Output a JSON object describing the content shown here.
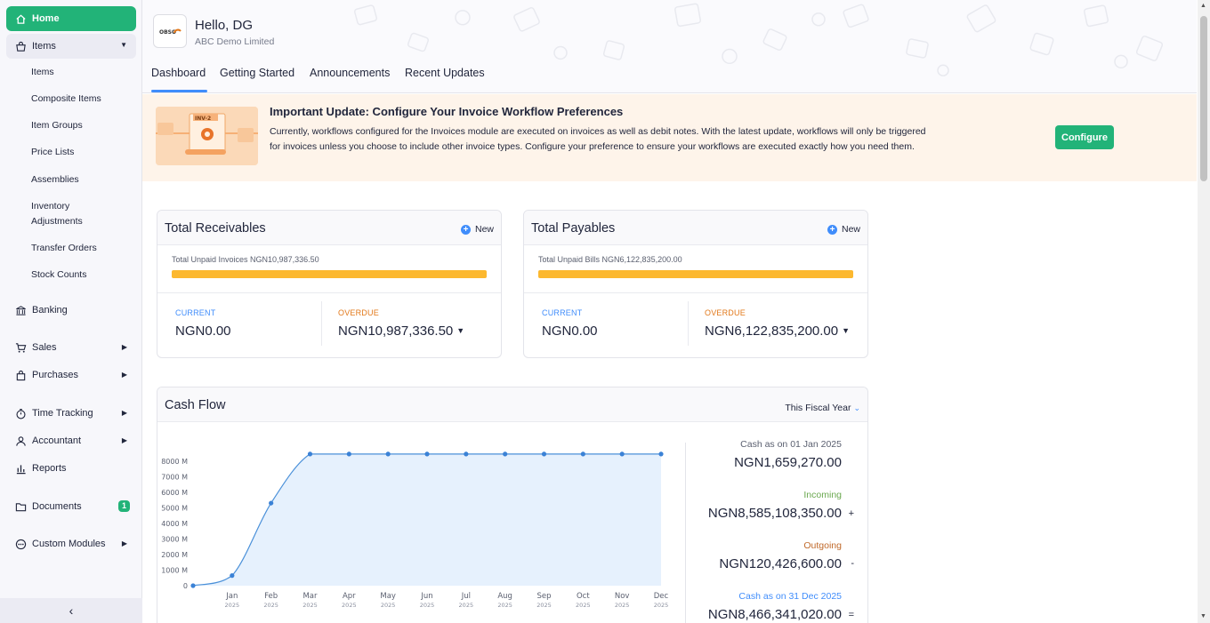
{
  "sidebar": {
    "home": "Home",
    "items_group": "Items",
    "items_sub": [
      "Items",
      "Composite Items",
      "Item Groups",
      "Price Lists",
      "Assemblies",
      "Inventory Adjustments",
      "Transfer Orders",
      "Stock Counts"
    ],
    "banking": "Banking",
    "sales": "Sales",
    "purchases": "Purchases",
    "time_tracking": "Time Tracking",
    "accountant": "Accountant",
    "reports": "Reports",
    "documents": "Documents",
    "documents_badge": "1",
    "custom_modules": "Custom Modules",
    "collapse_glyph": "‹"
  },
  "header": {
    "greeting": "Hello, DG",
    "org_name": "ABC Demo Limited",
    "logo_text": "OBSO",
    "tabs": [
      "Dashboard",
      "Getting Started",
      "Announcements",
      "Recent Updates"
    ]
  },
  "banner": {
    "image_label": "INV-2",
    "title": "Important Update: Configure Your Invoice Workflow Preferences",
    "text": "Currently, workflows configured for the Invoices module are executed on invoices as well as debit notes. With the latest update, workflows will only be triggered for invoices unless you choose to include other invoice types. Configure your preference to ensure your workflows are executed exactly how you need them.",
    "button": "Configure"
  },
  "receivables": {
    "title": "Total Receivables",
    "new_label": "New",
    "unpaid_label": "Total Unpaid Invoices NGN10,987,336.50",
    "progress_overdue_fraction": 1.0,
    "current_label": "CURRENT",
    "current_amount": "NGN0.00",
    "overdue_label": "OVERDUE",
    "overdue_amount": "NGN10,987,336.50"
  },
  "payables": {
    "title": "Total Payables",
    "new_label": "New",
    "unpaid_label": "Total Unpaid Bills NGN6,122,835,200.00",
    "progress_overdue_fraction": 1.0,
    "current_label": "CURRENT",
    "current_amount": "NGN0.00",
    "overdue_label": "OVERDUE",
    "overdue_amount": "NGN6,122,835,200.00"
  },
  "cashflow": {
    "title": "Cash Flow",
    "period": "This Fiscal Year",
    "summary": {
      "opening_label": "Cash as on 01 Jan 2025",
      "opening_amount": "NGN1,659,270.00",
      "incoming_label": "Incoming",
      "incoming_amount": "NGN8,585,108,350.00",
      "outgoing_label": "Outgoing",
      "outgoing_amount": "NGN120,426,600.00",
      "closing_label": "Cash as on 31 Dec 2025",
      "closing_amount": "NGN8,466,341,020.00"
    }
  },
  "colors": {
    "brand_green": "#22b378",
    "accent_blue": "#408dfb",
    "overdue_orange": "#e2781a",
    "progress_yellow": "#fcb82f",
    "incoming_green": "#6aa84f",
    "outgoing_orange": "#c0692a"
  },
  "chart_data": {
    "type": "area",
    "title": "Cash Flow",
    "xlabel": "",
    "ylabel": "",
    "categories": [
      "",
      "Jan\n2025",
      "Feb\n2025",
      "Mar\n2025",
      "Apr\n2025",
      "May\n2025",
      "Jun\n2025",
      "Jul\n2025",
      "Aug\n2025",
      "Sep\n2025",
      "Oct\n2025",
      "Nov\n2025",
      "Dec\n2025"
    ],
    "x_labels": [
      "Jan",
      "Feb",
      "Mar",
      "Apr",
      "May",
      "Jun",
      "Jul",
      "Aug",
      "Sep",
      "Oct",
      "Nov",
      "Dec"
    ],
    "x_year": "2025",
    "series": [
      {
        "values": [
          0,
          650,
          5300,
          8450,
          8450,
          8450,
          8450,
          8450,
          8450,
          8450,
          8450,
          8450,
          8450
        ]
      }
    ],
    "y_unit": "M",
    "yticks": [
      0,
      1000,
      2000,
      3000,
      4000,
      5000,
      6000,
      7000,
      8000
    ],
    "ytick_labels": [
      "0",
      "1000 M",
      "2000 M",
      "3000 M",
      "4000 M",
      "5000 M",
      "6000 M",
      "7000 M",
      "8000 M"
    ],
    "ylim": [
      0,
      8500
    ],
    "grid": false,
    "legend": "none"
  }
}
